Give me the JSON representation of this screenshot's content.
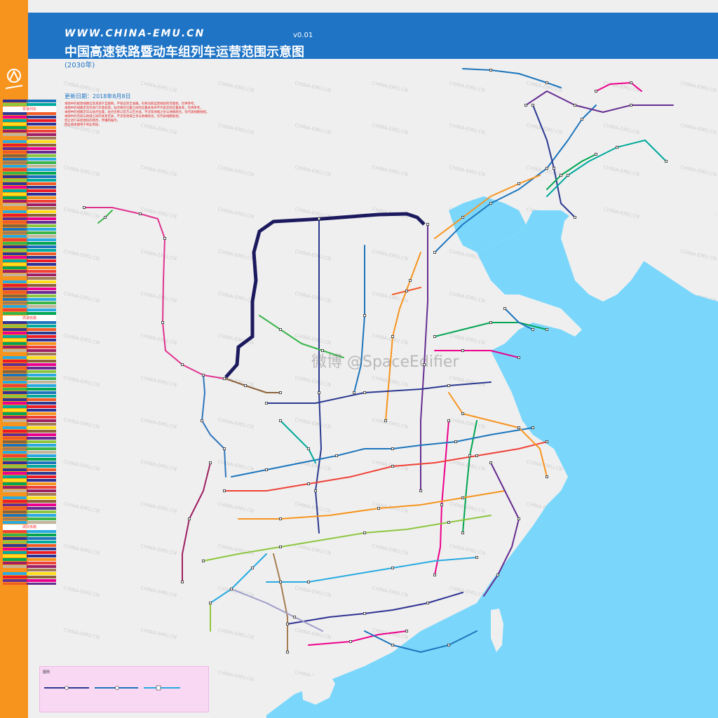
{
  "header": {
    "url": "WWW.CHINA-EMU.CN",
    "version": "v0.01",
    "title": "中国高速铁路暨动车组列车运营范围示意图",
    "year": "(2030年)"
  },
  "update_date": "更新日期：2018年8月8日",
  "notes": [
    "本图中的规划线路信息来源于互联网，不保证完全准确，有移动新运营规划的可能性，仅供参考。",
    "本图中的线路走向仅进行示意处理，站点相对位置之间的位置关系并不代表实际位置关系，仅供参考。",
    "本图中的线路走向与站点位置，站点名称以官方公告为准，不涉及地域之争与地缘政治，仅代表线路规划。",
    "本图中的内容与地域之间的关系无关，不涉及地域之争与地缘政治，仅代表线路规划。",
    "禁止进行未经授权的修改，传播和展示。",
    "禁止将本图用于商业用途。"
  ],
  "watermark": "微博 @SpaceEdifier",
  "background_text": "CHINA-EMU.CN",
  "map_legend_title": "图例",
  "legend_headers": [
    "普速列车",
    "高速铁路",
    "城际铁路"
  ],
  "colors": {
    "header": "#1f74c6",
    "sidebar": "#f7941d",
    "sea": "#7ad7fb",
    "land": "#efefef",
    "border_line": "#1c1a5e"
  }
}
